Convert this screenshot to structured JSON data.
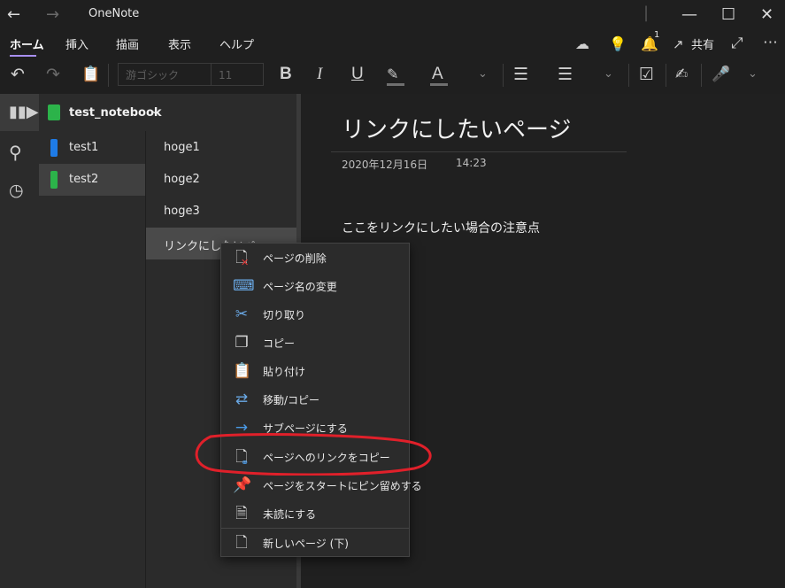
{
  "app": {
    "title": "OneNote"
  },
  "menu": {
    "tabs": [
      "ホーム",
      "挿入",
      "描画",
      "表示",
      "ヘルプ"
    ],
    "share_label": "共有",
    "notification_count": "1"
  },
  "toolbar": {
    "font_name": "游ゴシック",
    "font_size": "11"
  },
  "notebook": {
    "name": "test_notebook"
  },
  "sections": [
    {
      "label": "test1",
      "color": "#1e7be6"
    },
    {
      "label": "test2",
      "color": "#2cb34a"
    }
  ],
  "pages": [
    {
      "label": "hoge1"
    },
    {
      "label": "hoge2"
    },
    {
      "label": "hoge3"
    },
    {
      "label": "リンクにしたいペ..."
    }
  ],
  "content": {
    "title": "リンクにしたいページ",
    "date": "2020年12月16日",
    "time": "14:23",
    "body": "ここをリンクにしたい場合の注意点"
  },
  "context_menu": {
    "items": [
      {
        "label": "ページの削除",
        "icon": "delete-page-icon"
      },
      {
        "label": "ページ名の変更",
        "icon": "rename-icon"
      },
      {
        "label": "切り取り",
        "icon": "scissors-icon"
      },
      {
        "label": "コピー",
        "icon": "copy-icon"
      },
      {
        "label": "貼り付け",
        "icon": "paste-icon"
      },
      {
        "label": "移動/コピー",
        "icon": "move-icon"
      },
      {
        "label": "サブページにする",
        "icon": "arrow-right-icon"
      },
      {
        "label": "ページへのリンクをコピー",
        "icon": "link-page-icon"
      },
      {
        "label": "ページをスタートにピン留めする",
        "icon": "pin-icon"
      },
      {
        "label": "未読にする",
        "icon": "unread-icon"
      },
      {
        "label": "新しいページ (下)",
        "icon": "new-page-icon"
      }
    ]
  },
  "colors": {
    "accent": "#a88ff0",
    "annotation": "#e0202a"
  }
}
